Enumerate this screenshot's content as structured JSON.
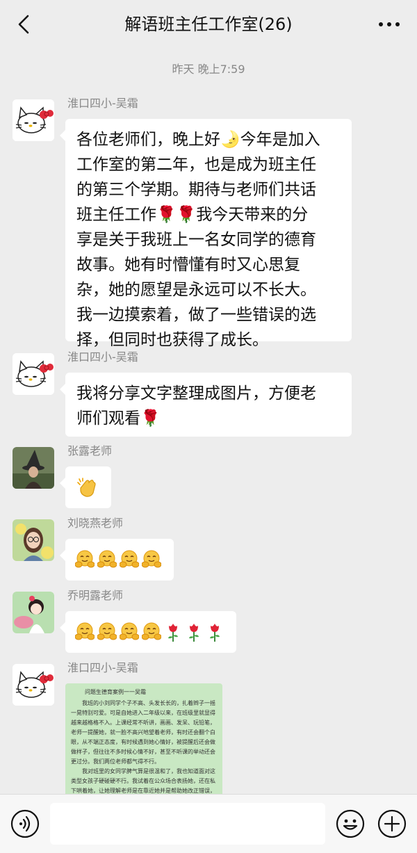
{
  "header": {
    "title": "解语班主任工作室(26)"
  },
  "chat": {
    "timestamp": "昨天 晚上7:59",
    "messages": [
      {
        "sender": "淮口四小-吴霜",
        "text_lines": [
          "各位老师们，晚上好🌛今年是加入",
          "工作室的第二年，也是成为班主任",
          "的第三个学期。期待与老师们共话",
          "班主任工作🌹🌹我今天带来的分",
          "享是关于我班上一名女同学的德育",
          "故事。她有时懵懂有时又心思复",
          "杂，她的愿望是永远可以不长大。",
          "我一边摸索着，做了一些错误的选",
          "择，但同时也获得了成长。"
        ]
      },
      {
        "sender": "淮口四小-吴霜",
        "text_lines": [
          "我将分享文字整理成图片，方便老",
          "师们观看🌹"
        ]
      },
      {
        "sender": "张露老师",
        "emoji": [
          "clap"
        ]
      },
      {
        "sender": "刘晓燕老师",
        "emoji": [
          "hug",
          "hug",
          "hug",
          "hug"
        ]
      },
      {
        "sender": "乔明露老师",
        "emoji": [
          "hug",
          "hug",
          "hug",
          "hug",
          "rose",
          "rose",
          "rose"
        ]
      },
      {
        "sender": "淮口四小-吴霜",
        "image": {
          "title": "问题生德育案例一一吴霜",
          "paragraphs": [
            "我班的小刘同学个子不高、头发长长的，扎着辫子一摇一晃特别可爱。可是自她进入二年级以来，在班级里就显得越来越格格不入。上课经常不听讲，画画、发呆、玩铅笔，老师一提醒她，就一脸不高兴地望着老师，有时还会翻个白眼，从不端正态度，有时候遇到她心情好，被提醒后还会做做样子，但往往不多时候心情不好，甚至不听课的举动还会更过分。我们两位老师都气得不行。",
            "我对班里的女同学脾气算是很温和了，我也知道面对这类型女孩子硬碰硬不行。我试着在公众场合表扬她，还在私下哄着她，让她理解老师是在靠近她并是帮助她改正错误，当上"
          ]
        }
      }
    ]
  },
  "input": {
    "placeholder": ""
  }
}
